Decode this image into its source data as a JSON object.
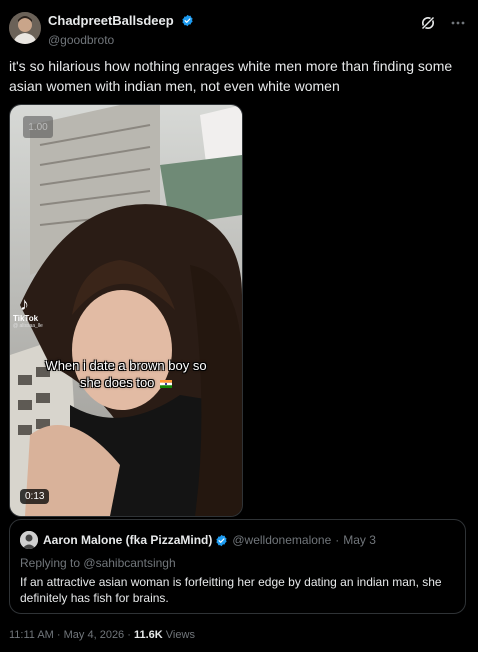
{
  "tweet": {
    "author": {
      "display_name": "ChadpreetBallsdeep",
      "handle": "@goodbroto",
      "verified_color": "#1d9bf0"
    },
    "actions": {
      "grok_icon": "grok-icon",
      "more_icon": "more-icon"
    },
    "text": "it's so hilarious how nothing enrages white men more than finding some asian women with indian men, not even white women",
    "media": {
      "playback_speed": "1.00",
      "watermark": "TikTok",
      "watermark_user": "@ alissaa_lle",
      "caption_line1": "When i date a brown boy so",
      "caption_line2": "she does too",
      "duration": "0:13"
    },
    "quote": {
      "display_name": "Aaron Malone (fka PizzaMind)",
      "handle": "@welldonemalone",
      "separator": "·",
      "date": "May 3",
      "reply_prefix": "Replying to",
      "reply_to": "@sahibcantsingh",
      "text": "If an attractive asian woman is forfeitting her edge by dating an indian man, she definitely has fish for brains."
    },
    "meta": {
      "time": "11:11 AM",
      "sep1": "·",
      "date": "May 4, 2026",
      "sep2": "·",
      "views_count": "11.6K",
      "views_label": "Views"
    }
  },
  "colors": {
    "background": "#000000",
    "text": "#e7e9ea",
    "muted": "#71767b",
    "border": "#2f3336",
    "verified": "#1d9bf0"
  }
}
